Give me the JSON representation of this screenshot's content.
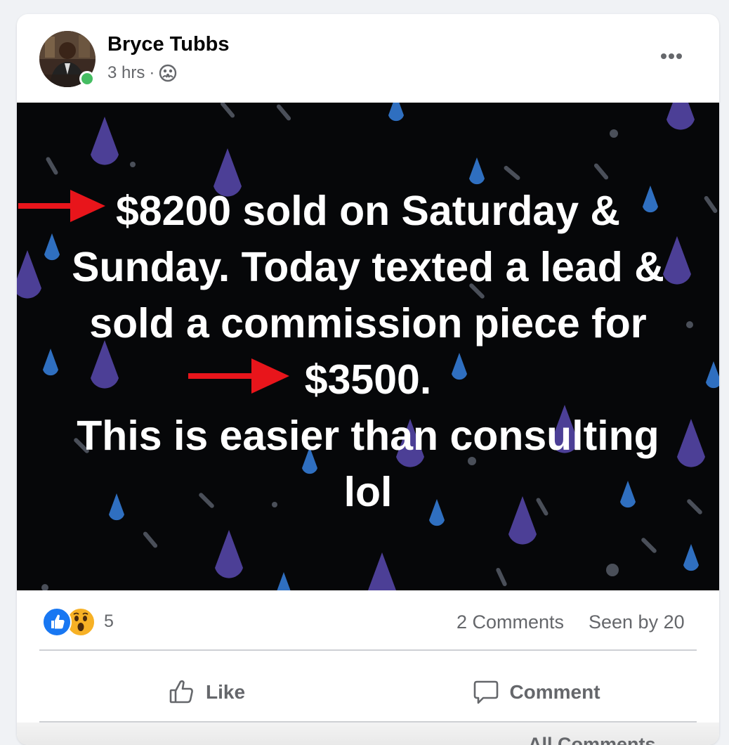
{
  "post": {
    "author": "Bryce Tubbs",
    "time": "3 hrs",
    "separator": "·",
    "audience_icon": "group-icon",
    "more_icon": "more-options-icon",
    "text": "$8200 sold on Saturday &\nSunday. Today texted a lead &\nsold a commission piece for\n$3500.\nThis is easier than consulting\nlol",
    "background_color": "#060709",
    "arrow_color": "#e8151b"
  },
  "stats": {
    "reactions": [
      "like",
      "wow"
    ],
    "reaction_count": "5",
    "comments": "2 Comments",
    "seen_by": "Seen by 20"
  },
  "actions": {
    "like": "Like",
    "comment": "Comment"
  },
  "comments_section": {
    "filter_label": "All Comments"
  }
}
